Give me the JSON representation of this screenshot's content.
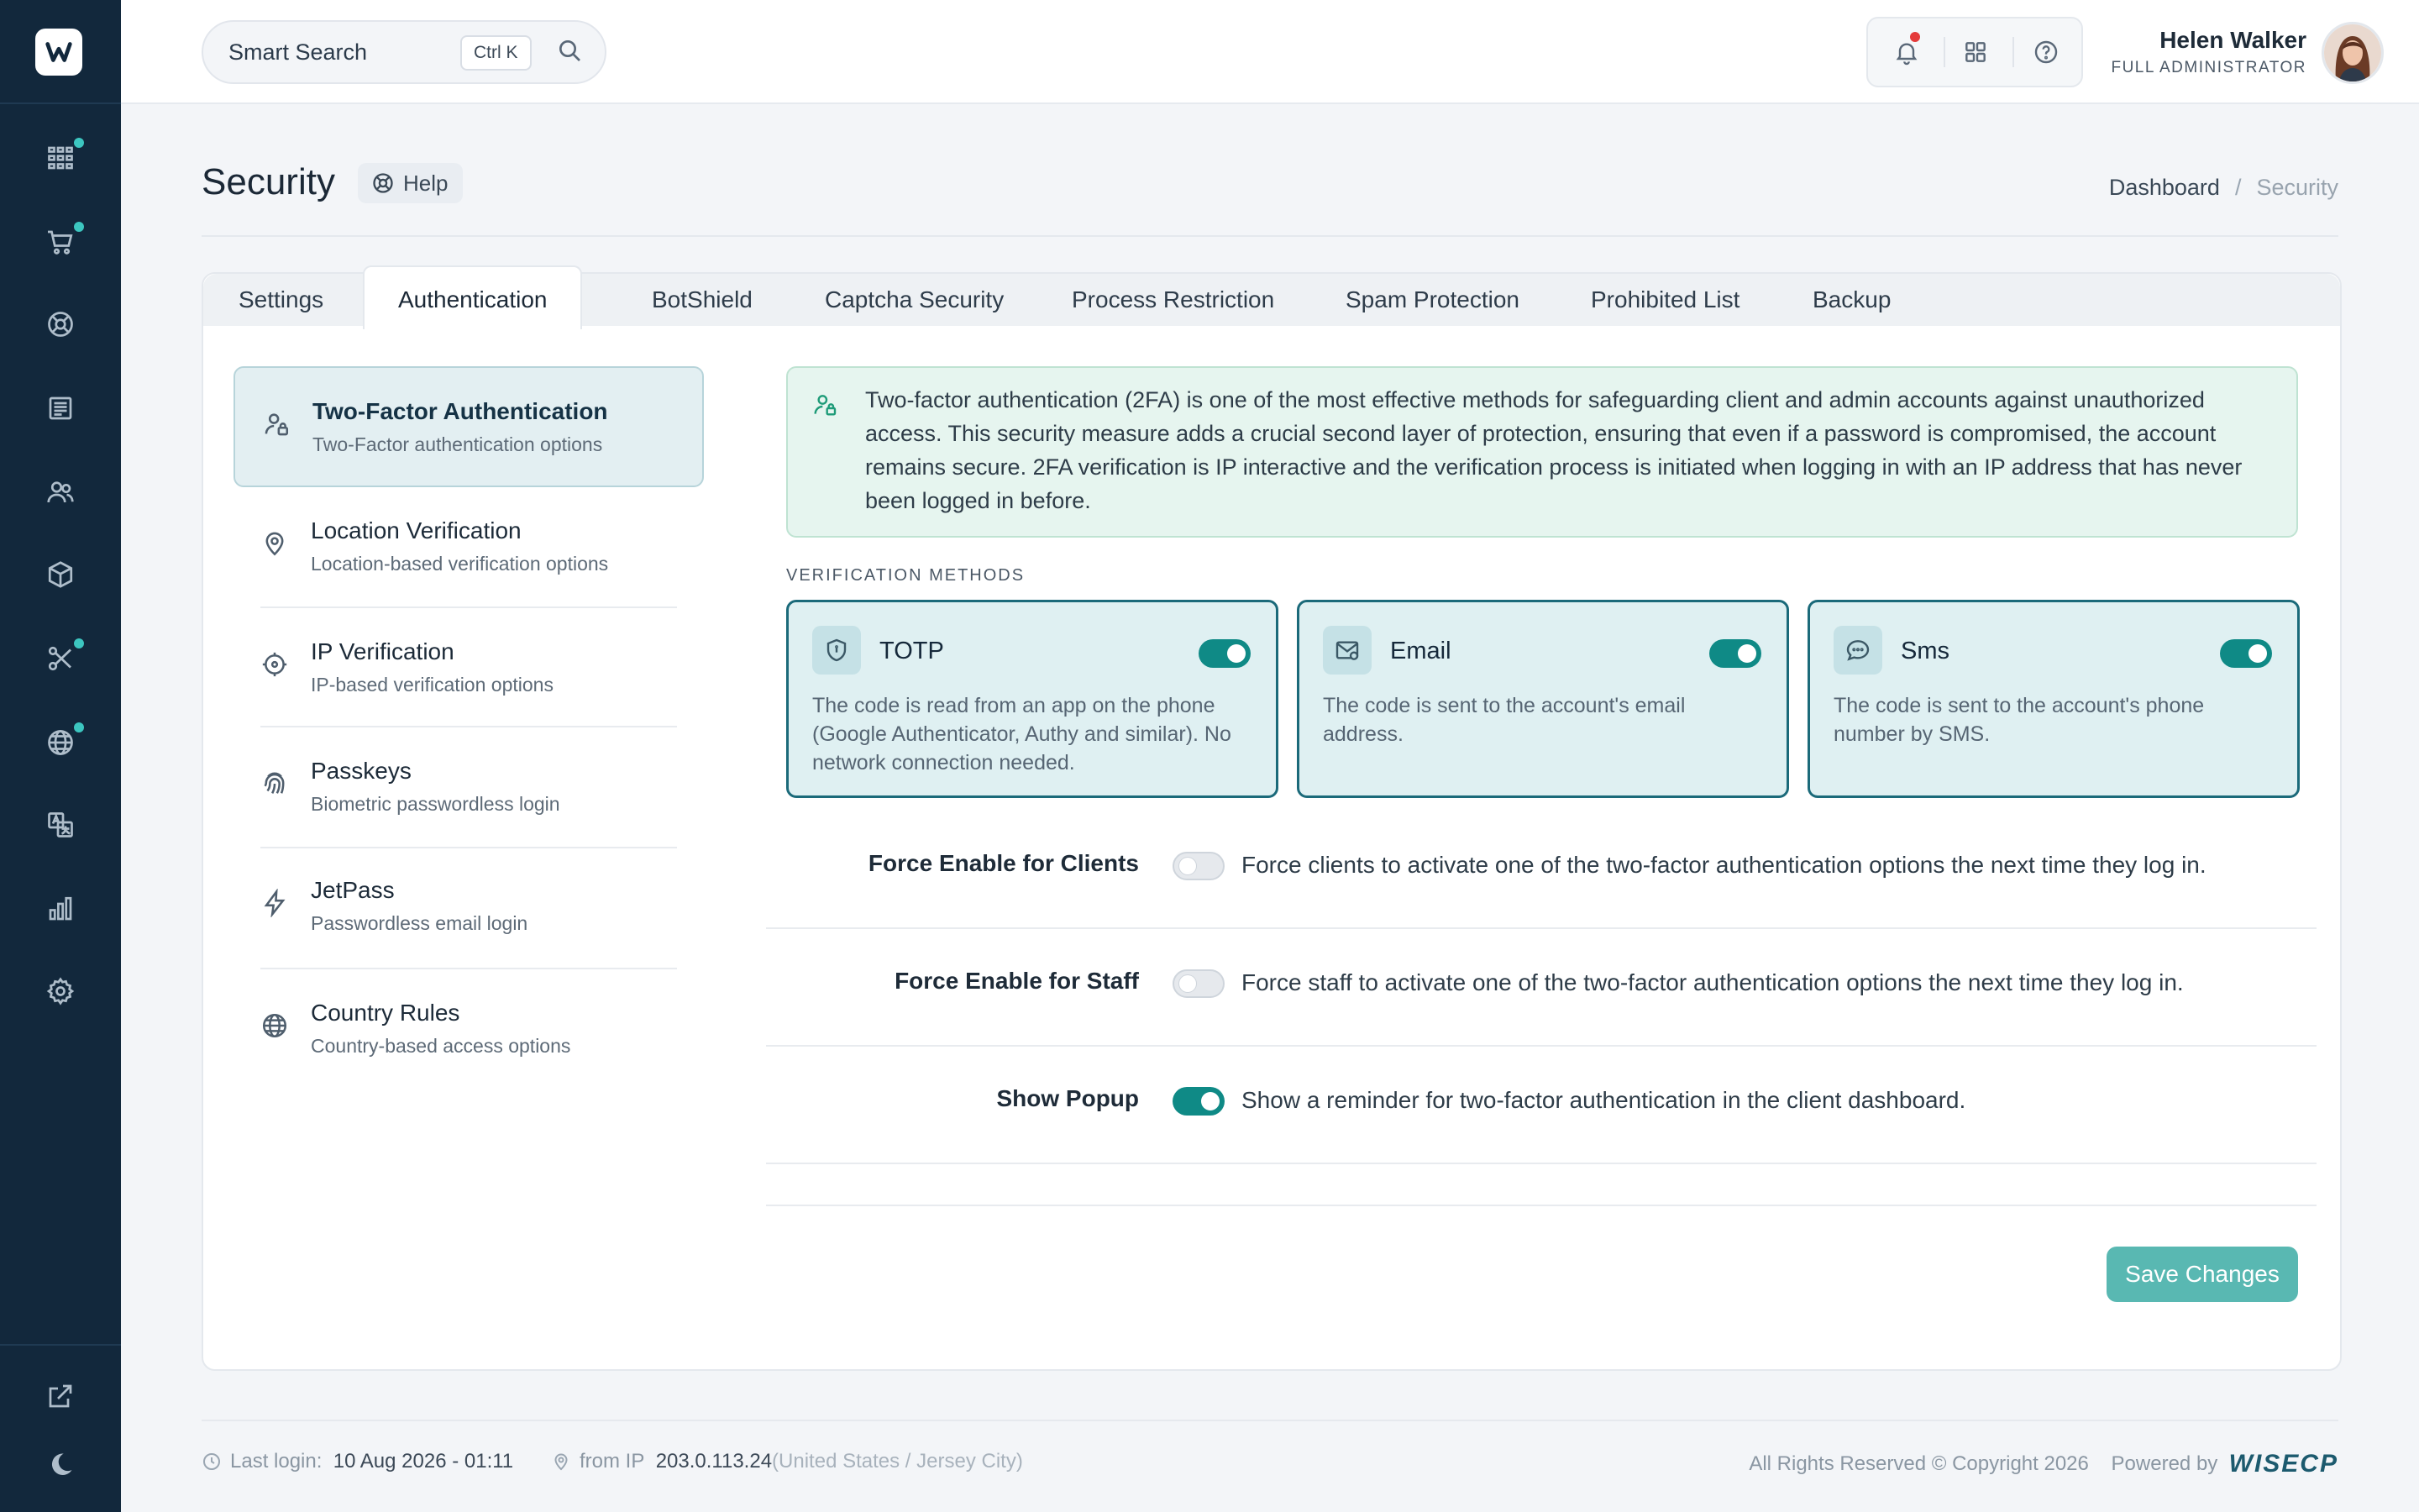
{
  "search": {
    "placeholder": "Smart Search",
    "shortcut": "Ctrl K"
  },
  "user": {
    "name": "Helen Walker",
    "role": "FULL ADMINISTRATOR"
  },
  "page": {
    "title": "Security",
    "help_label": "Help"
  },
  "breadcrumb": {
    "items": [
      "Dashboard",
      "Security"
    ],
    "separator": "/"
  },
  "tabs": [
    {
      "label": "Settings"
    },
    {
      "label": "Authentication",
      "active": true
    },
    {
      "label": "BotShield"
    },
    {
      "label": "Captcha Security"
    },
    {
      "label": "Process Restriction"
    },
    {
      "label": "Spam Protection"
    },
    {
      "label": "Prohibited List"
    },
    {
      "label": "Backup"
    }
  ],
  "menu": [
    {
      "title": "Two-Factor Authentication",
      "subtitle": "Two-Factor authentication options",
      "icon": "user-lock-icon",
      "active": true
    },
    {
      "title": "Location Verification",
      "subtitle": "Location-based verification options",
      "icon": "location-pin-icon"
    },
    {
      "title": "IP Verification",
      "subtitle": "IP-based verification options",
      "icon": "crosshair-icon"
    },
    {
      "title": "Passkeys",
      "subtitle": "Biometric passwordless login",
      "icon": "fingerprint-icon"
    },
    {
      "title": "JetPass",
      "subtitle": "Passwordless email login",
      "icon": "lightning-icon"
    },
    {
      "title": "Country Rules",
      "subtitle": "Country-based access options",
      "icon": "globe-icon"
    }
  ],
  "info": {
    "text": "Two-factor authentication (2FA) is one of the most effective methods for safeguarding client and admin accounts against unauthorized access. This security measure adds a crucial second layer of protection, ensuring that even if a password is compromised, the account remains secure. 2FA verification is IP interactive and the verification process is initiated when logging in with an IP address that has never been logged in before."
  },
  "verification": {
    "label": "VERIFICATION METHODS",
    "methods": [
      {
        "title": "TOTP",
        "desc": "The code is read from an app on the phone (Google Authenticator, Authy and similar). No network connection needed.",
        "enabled": true,
        "icon": "shield-icon"
      },
      {
        "title": "Email",
        "desc": "The code is sent to the account's email address.",
        "enabled": true,
        "icon": "envelope-icon"
      },
      {
        "title": "Sms",
        "desc": "The code is sent to the account's phone number by SMS.",
        "enabled": true,
        "icon": "chat-bubble-icon"
      }
    ]
  },
  "options": [
    {
      "label": "Force Enable for Clients",
      "desc": "Force clients to activate one of the two-factor authentication options the next time they log in.",
      "enabled": false
    },
    {
      "label": "Force Enable for Staff",
      "desc": "Force staff to activate one of the two-factor authentication options the next time they log in.",
      "enabled": false
    },
    {
      "label": "Show Popup",
      "desc": "Show a reminder for two-factor authentication in the client dashboard.",
      "enabled": true
    }
  ],
  "save_label": "Save Changes",
  "footer": {
    "last_login_label": "Last login:",
    "last_login_value": "10 Aug 2026 - 01:11",
    "ip_label": "from IP",
    "ip_value": "203.0.113.24",
    "ip_location": "(United States / Jersey City)",
    "copyright": "All Rights Reserved © Copyright 2026",
    "powered_by": "Powered by",
    "brand": "WISECP"
  },
  "colors": {
    "sidebar": "#12283c",
    "accent": "#0f8a86",
    "notification": "#e43b3b",
    "badge": "#3cc6c0"
  }
}
